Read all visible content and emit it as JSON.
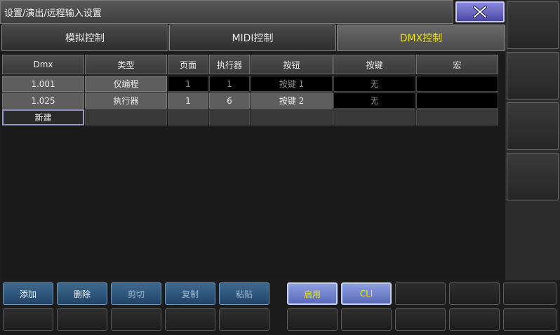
{
  "window": {
    "title": "设置/演出/远程输入设置",
    "close_icon": "close-x-icon"
  },
  "tabs": [
    {
      "label": "模拟控制",
      "active": false
    },
    {
      "label": "MIDI控制",
      "active": false
    },
    {
      "label": "DMX控制",
      "active": true
    }
  ],
  "table": {
    "columns": [
      "Dmx",
      "类型",
      "页面",
      "执行器",
      "按钮",
      "按键",
      "宏"
    ],
    "rows": [
      {
        "dmx": "1.001",
        "type": "仅编程",
        "page": "1",
        "executor": "1",
        "button": "按键 1",
        "key": "无",
        "macro": ""
      },
      {
        "dmx": "1.025",
        "type": "执行器",
        "page": "1",
        "executor": "6",
        "button": "按键 2",
        "key": "无",
        "macro": ""
      }
    ],
    "new_label": "新建"
  },
  "actions": {
    "add": "添加",
    "delete": "删除",
    "cut": "剪切",
    "copy": "复制",
    "paste": "粘贴",
    "enable": "启用",
    "cli": "CLI"
  },
  "colors": {
    "active_tab_text": "#f0e020",
    "close_button": "#6a68c8",
    "action_blue": "#2e5478"
  }
}
